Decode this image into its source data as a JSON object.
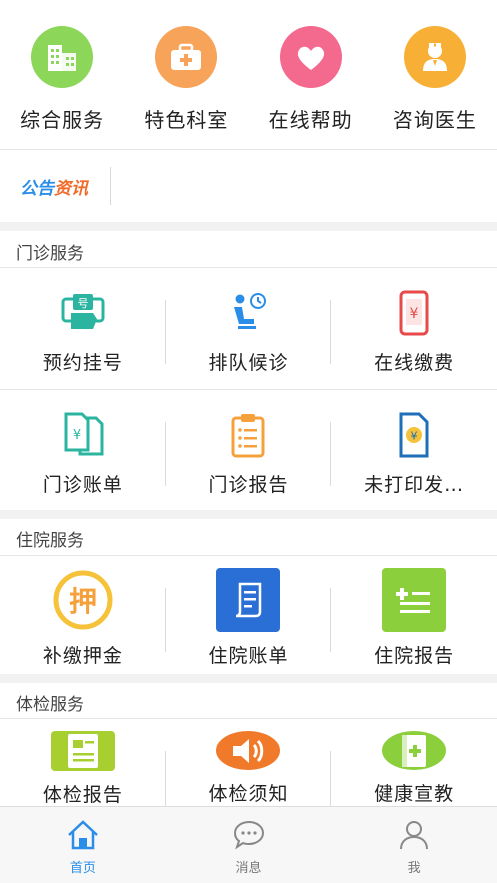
{
  "top_actions": [
    {
      "label": "综合服务",
      "icon": "building-icon",
      "color": "#8cd65a"
    },
    {
      "label": "特色科室",
      "icon": "medical-kit-icon",
      "color": "#f7a45a"
    },
    {
      "label": "在线帮助",
      "icon": "heart-icon",
      "color": "#f46a8f"
    },
    {
      "label": "咨询医生",
      "icon": "doctor-icon",
      "color": "#f7b035"
    }
  ],
  "notice": {
    "label_part1": "公告",
    "label_part2": "资讯",
    "color1": "#2a8ee8",
    "color2": "#f06b2a"
  },
  "sections": {
    "outpatient": {
      "title": "门诊服务",
      "items": [
        {
          "label": "预约挂号",
          "icon": "register-hand-icon"
        },
        {
          "label": "排队候诊",
          "icon": "waiting-queue-icon"
        },
        {
          "label": "在线缴费",
          "icon": "mobile-payment-icon"
        },
        {
          "label": "门诊账单",
          "icon": "bill-documents-icon"
        },
        {
          "label": "门诊报告",
          "icon": "clipboard-report-icon"
        },
        {
          "label": "未打印发…",
          "icon": "invoice-icon"
        }
      ]
    },
    "inpatient": {
      "title": "住院服务",
      "items": [
        {
          "label": "补缴押金",
          "icon": "deposit-icon"
        },
        {
          "label": "住院账单",
          "icon": "scroll-bill-icon"
        },
        {
          "label": "住院报告",
          "icon": "report-list-icon"
        }
      ]
    },
    "checkup": {
      "title": "体检服务",
      "items": [
        {
          "label": "体检报告",
          "icon": "checkup-report-icon"
        },
        {
          "label": "体检须知",
          "icon": "speaker-icon"
        },
        {
          "label": "健康宣教",
          "icon": "health-book-icon"
        }
      ]
    }
  },
  "tabbar": [
    {
      "label": "首页",
      "icon": "home-icon",
      "active": true
    },
    {
      "label": "消息",
      "icon": "message-icon",
      "active": false
    },
    {
      "label": "我",
      "icon": "user-icon",
      "active": false
    }
  ],
  "colors": {
    "accent": "#2a8ee8",
    "teal": "#2bb5a0",
    "orange": "#f5a03a",
    "red": "#e84a4a",
    "blue_tile": "#2a6fd6",
    "green_tile": "#8ccf3c"
  }
}
